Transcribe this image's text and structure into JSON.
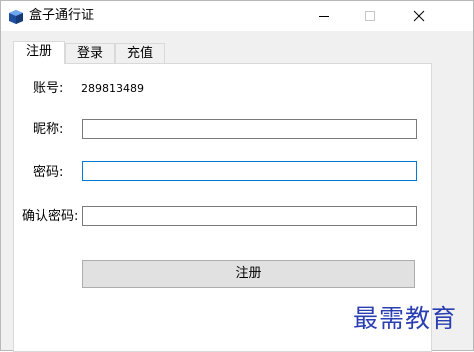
{
  "window": {
    "title": "盒子通行证",
    "icon": "box-icon",
    "controls": [
      "minimize-icon",
      "maximize-icon",
      "close-icon"
    ]
  },
  "tabs": [
    {
      "label": "注册",
      "active": true
    },
    {
      "label": "登录",
      "active": false
    },
    {
      "label": "充值",
      "active": false
    }
  ],
  "form": {
    "account_label": "账号:",
    "account_value": "289813489",
    "nickname_label": "昵称:",
    "nickname_value": "",
    "password_label": "密码:",
    "password_value": "",
    "confirm_label": "确认密码:",
    "confirm_value": "",
    "submit_label": "注册"
  },
  "watermark": "最需教育",
  "colors": {
    "focus_border": "#0078d7",
    "watermark": "#2a3fb0"
  }
}
